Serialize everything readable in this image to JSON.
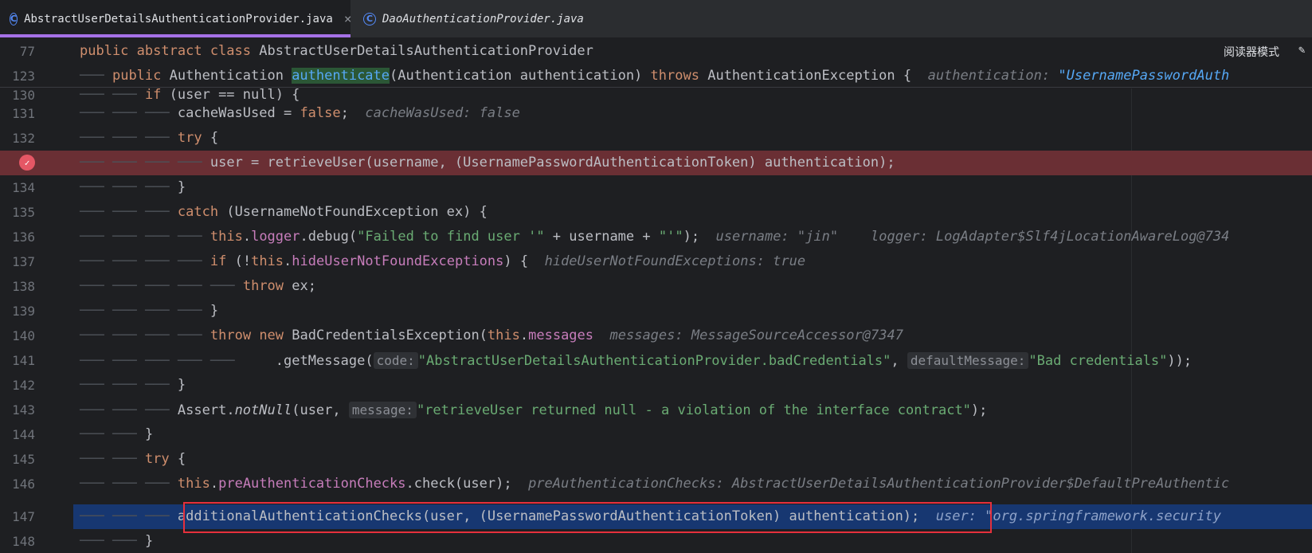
{
  "tabs": [
    {
      "label": "AbstractUserDetailsAuthenticationProvider.java",
      "icon": "class-icon",
      "icon_glyph": "C",
      "close": "×"
    },
    {
      "label": "DaoAuthenticationProvider.java",
      "icon": "class-icon",
      "icon_glyph": "C"
    }
  ],
  "toolbar": {
    "reader_mode_label": "阅读器模式",
    "reader_icon": "✎"
  },
  "sticky": [
    {
      "num": "77"
    },
    {
      "num": "123"
    }
  ],
  "lines": [
    {
      "num": "130"
    },
    {
      "num": "131"
    },
    {
      "num": "132"
    },
    {
      "num": "133"
    },
    {
      "num": "134"
    },
    {
      "num": "135"
    },
    {
      "num": "136"
    },
    {
      "num": "137"
    },
    {
      "num": "138"
    },
    {
      "num": "139"
    },
    {
      "num": "140"
    },
    {
      "num": "141"
    },
    {
      "num": "142"
    },
    {
      "num": "143"
    },
    {
      "num": "144"
    },
    {
      "num": "145"
    },
    {
      "num": "146"
    },
    {
      "num": "147"
    },
    {
      "num": "148"
    }
  ],
  "code": {
    "l77": {
      "kw1": "public",
      "kw2": "abstract",
      "kw3": "class",
      "name": "AbstractUserDetailsAuthenticationProvider"
    },
    "l123": {
      "kw1": "public",
      "type": "Authentication",
      "method": "authenticate",
      "params": "(Authentication authentication)",
      "kw2": "throws",
      "exc": "AuthenticationException {",
      "hint_name": "authentication:",
      "hint_val": "\"UsernamePasswordAuth"
    },
    "l130": {
      "kw": "if",
      "rest": " (user == null) {"
    },
    "l131": {
      "var": "cacheWasUsed = ",
      "kw": "false",
      "semi": ";",
      "hint": "cacheWasUsed: false"
    },
    "l132": {
      "kw": "try",
      "rest": " {"
    },
    "l133": {
      "text": "user = retrieveUser(username, (UsernamePasswordAuthenticationToken) authentication);"
    },
    "l134": {
      "text": "}"
    },
    "l135": {
      "kw": "catch",
      "rest": " (UsernameNotFoundException ex) {"
    },
    "l136": {
      "kw": "this",
      "dot": ".",
      "fld": "logger",
      "call": ".debug(",
      "str1": "\"Failed to find user '\"",
      "mid": " + username + ",
      "str2": "\"'\"",
      "end": ");",
      "hint1": "username: \"jin\"",
      "hint2": "logger: LogAdapter$Slf4jLocationAwareLog@734"
    },
    "l137": {
      "kw": "if",
      "pre": " (!",
      "kw2": "this",
      "dot": ".",
      "fld": "hideUserNotFoundExceptions",
      "end": ") {",
      "hint": "hideUserNotFoundExceptions: true"
    },
    "l138": {
      "kw": "throw",
      "rest": " ex;"
    },
    "l139": {
      "text": "}"
    },
    "l140": {
      "kw1": "throw",
      "kw2": "new",
      "cls": "BadCredentialsException(",
      "kw3": "this",
      "dot": ".",
      "fld": "messages",
      "hint": "messages: MessageSourceAccessor@7347"
    },
    "l141": {
      "call": ".getMessage(",
      "p1": "code:",
      "s1": "\"AbstractUserDetailsAuthenticationProvider.badCredentials\"",
      "comma": ", ",
      "p2": "defaultMessage:",
      "s2": "\"Bad credentials\"",
      "end": "));"
    },
    "l142": {
      "text": "}"
    },
    "l143": {
      "cls": "Assert.",
      "fn": "notNull",
      "pre": "(user, ",
      "p1": "message:",
      "s1": "\"retrieveUser returned null - a violation of the interface contract\"",
      "end": ");"
    },
    "l144": {
      "text": "}"
    },
    "l145": {
      "kw": "try",
      "rest": " {"
    },
    "l146": {
      "kw": "this",
      "dot": ".",
      "fld": "preAuthenticationChecks",
      "rest": ".check(user);",
      "hint": "preAuthenticationChecks: AbstractUserDetailsAuthenticationProvider$DefaultPreAuthentic"
    },
    "l147": {
      "text": "additionalAuthenticationChecks(user, (UsernamePasswordAuthenticationToken) authentication);",
      "hint": "user: \"org.springframework.security"
    },
    "l148": {
      "text": "}"
    }
  },
  "colors": {
    "keyword": "#cf8e6d",
    "field": "#c77dbb",
    "string": "#6aab73",
    "method": "#56a8f5",
    "breakpoint_row": "#6a2f34",
    "execution_row": "#173771",
    "highlight_box": "#e5303c"
  }
}
